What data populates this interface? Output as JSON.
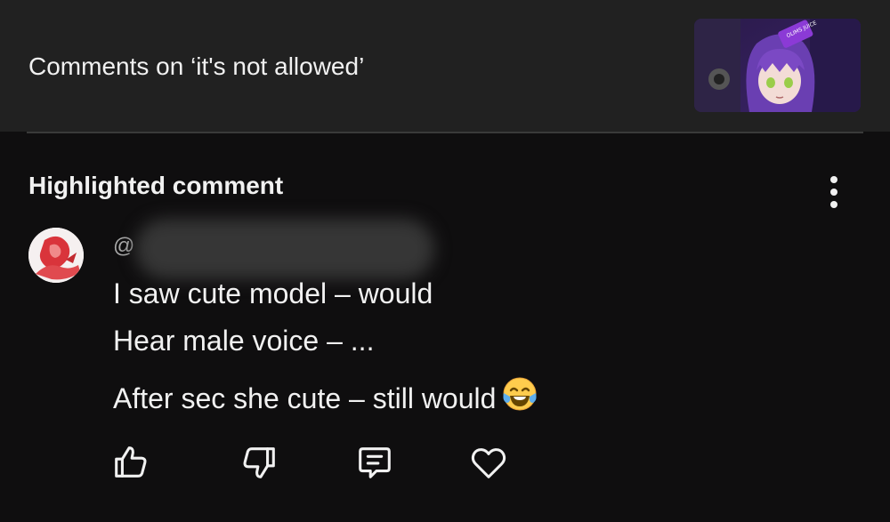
{
  "header": {
    "title": "Comments on ‘it's not allowed’",
    "thumbnail_text": "OLIMS JUICE"
  },
  "highlighted": {
    "section_title": "Highlighted comment",
    "author_handle_prefix": "@",
    "comment_lines": [
      "I saw cute model – would",
      "Hear male voice – ...",
      "After sec she cute – still would"
    ],
    "emoji": "face-with-tears-of-joy"
  },
  "actions": [
    {
      "icon": "thumb-up-icon"
    },
    {
      "icon": "thumb-down-icon"
    },
    {
      "icon": "reply-icon"
    },
    {
      "icon": "heart-icon"
    }
  ],
  "colors": {
    "background": "#0f0e0f",
    "header_background": "#212121",
    "text": "#f1f1f1",
    "secondary_text": "#aaaaaa"
  }
}
